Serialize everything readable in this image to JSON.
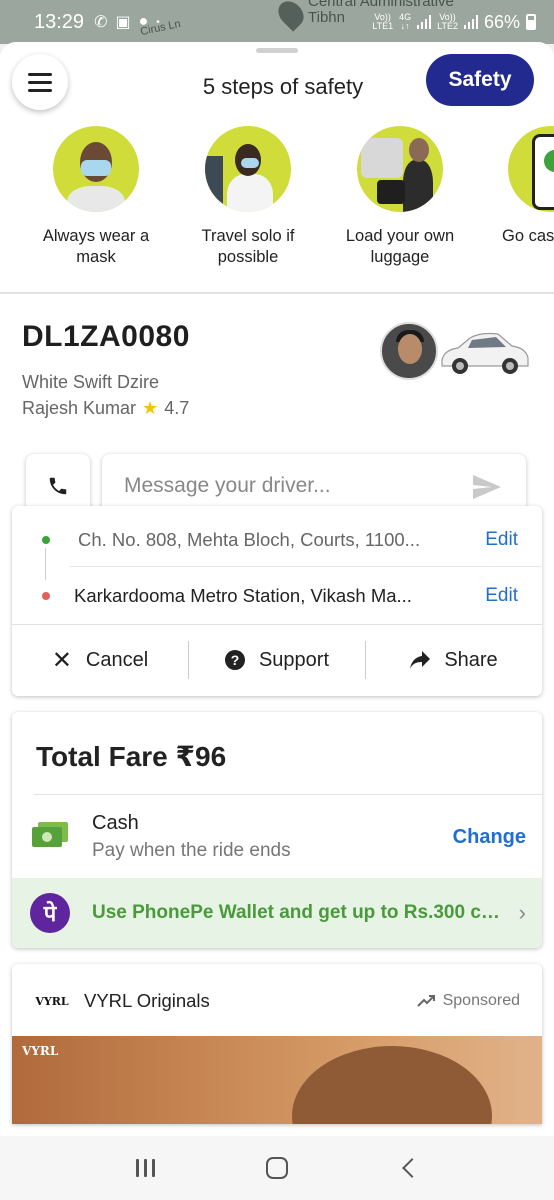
{
  "status_bar": {
    "time": "13:29",
    "map_label_1": "Central Administrative",
    "map_label_2": "Tibhn",
    "map_street": "Cirus Ln",
    "sim1_top": "Vo))",
    "sim1_bottom": "LTE1",
    "net_top": "4G",
    "net_bottom": "↓↑",
    "sim2_top": "Vo))",
    "sim2_bottom": "LTE2",
    "battery": "66%"
  },
  "header": {
    "title": "5 steps of safety",
    "safety_button": "Safety"
  },
  "safety_steps": [
    {
      "label": "Always wear a mask"
    },
    {
      "label": "Travel solo if possible"
    },
    {
      "label": "Load your own luggage"
    },
    {
      "label": "Go cas limit co"
    }
  ],
  "driver": {
    "plate": "DL1ZA0080",
    "car_model": "White Swift Dzire",
    "name": "Rajesh Kumar",
    "rating": "4.7"
  },
  "message": {
    "placeholder": "Message your driver..."
  },
  "route": {
    "pickup": "Ch. No. 808, Mehta Bloch, Courts, 1100...",
    "drop": "Karkardooma Metro Station, Vikash Ma...",
    "edit_label": "Edit",
    "pickup_color": "#3aa33a",
    "drop_color": "#e0605a"
  },
  "actions": {
    "cancel": "Cancel",
    "support": "Support",
    "share": "Share"
  },
  "fare": {
    "title": "Total Fare ₹96",
    "method": "Cash",
    "method_sub": "Pay when the ride ends",
    "change": "Change",
    "promo_logo": "पे",
    "promo": "Use PhonePe Wallet and get up to Rs.300 ca..."
  },
  "ad": {
    "logo": "VYRL",
    "name": "VYRL Originals",
    "sponsored": "Sponsored"
  },
  "colors": {
    "accent": "#232a8f",
    "link": "#1f6fd1",
    "safety_circle": "#cfdc3a",
    "promo_bg": "#e6f3e5",
    "promo_text": "#4a9a3c"
  }
}
